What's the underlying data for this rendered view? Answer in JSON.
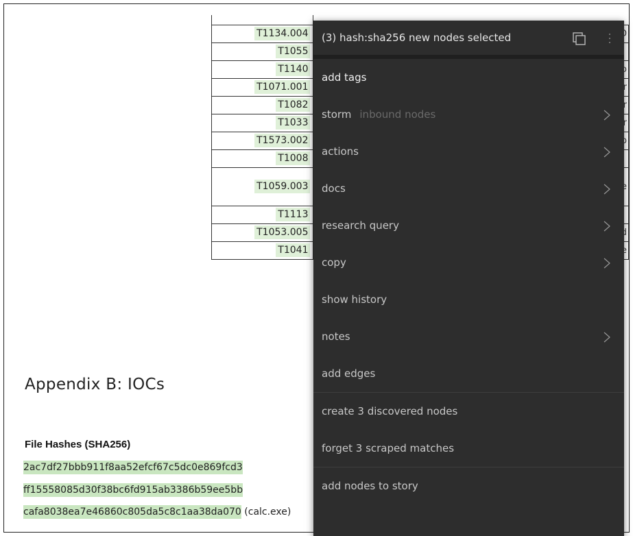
{
  "table": {
    "rows": [
      {
        "id": "",
        "desc": "",
        "cls": "first"
      },
      {
        "id": "T1134.004",
        "desc": "ID"
      },
      {
        "id": "T1055",
        "desc": ""
      },
      {
        "id": "T1140",
        "desc": "o"
      },
      {
        "id": "T1071.001",
        "desc": "Pr"
      },
      {
        "id": "T1082",
        "desc": "er"
      },
      {
        "id": "T1033",
        "desc": "er"
      },
      {
        "id": "T1573.002",
        "desc": "p"
      },
      {
        "id": "T1008",
        "desc": ""
      },
      {
        "id": "T1059.003",
        "desc": "de",
        "cls": "tall"
      },
      {
        "id": "T1113",
        "desc": ""
      },
      {
        "id": "T1053.005",
        "desc": "d"
      },
      {
        "id": "T1041",
        "desc": "e"
      }
    ]
  },
  "appendix": {
    "title": "Appendix B: IOCs",
    "hash_heading": "File Hashes (SHA256)",
    "hashes": [
      {
        "value": "2ac7df27bbb911f8aa52efcf67c5dc0e869fcd3",
        "suffix": ""
      },
      {
        "value": "ff15558085d30f38bc6fd915ab3386b59ee5bb",
        "suffix": ""
      },
      {
        "value": "cafa8038ea7e46860c805da5c8c1aa38da070",
        "suffix": " (calc.exe)"
      }
    ]
  },
  "menu": {
    "header": "(3) hash:sha256 new nodes selected",
    "items": [
      {
        "label": "add tags",
        "sub": "",
        "chevron": false,
        "bright": true
      },
      {
        "label": "storm",
        "sub": "inbound nodes",
        "chevron": true,
        "bright": false
      },
      {
        "label": "actions",
        "sub": "",
        "chevron": true,
        "bright": false
      },
      {
        "label": "docs",
        "sub": "",
        "chevron": true,
        "bright": false
      },
      {
        "label": "research query",
        "sub": "",
        "chevron": true,
        "bright": false
      },
      {
        "label": "copy",
        "sub": "",
        "chevron": true,
        "bright": false
      },
      {
        "label": "show history",
        "sub": "",
        "chevron": false,
        "bright": false
      },
      {
        "label": "notes",
        "sub": "",
        "chevron": true,
        "bright": false
      },
      {
        "label": "add edges",
        "sub": "",
        "chevron": false,
        "bright": false
      },
      {
        "label": "create 3 discovered nodes",
        "sub": "",
        "chevron": false,
        "bright": false,
        "divider_before": true
      },
      {
        "label": "forget 3 scraped matches",
        "sub": "",
        "chevron": false,
        "bright": false
      },
      {
        "label": "add nodes to story",
        "sub": "",
        "chevron": false,
        "bright": false,
        "divider_before": true
      }
    ]
  }
}
